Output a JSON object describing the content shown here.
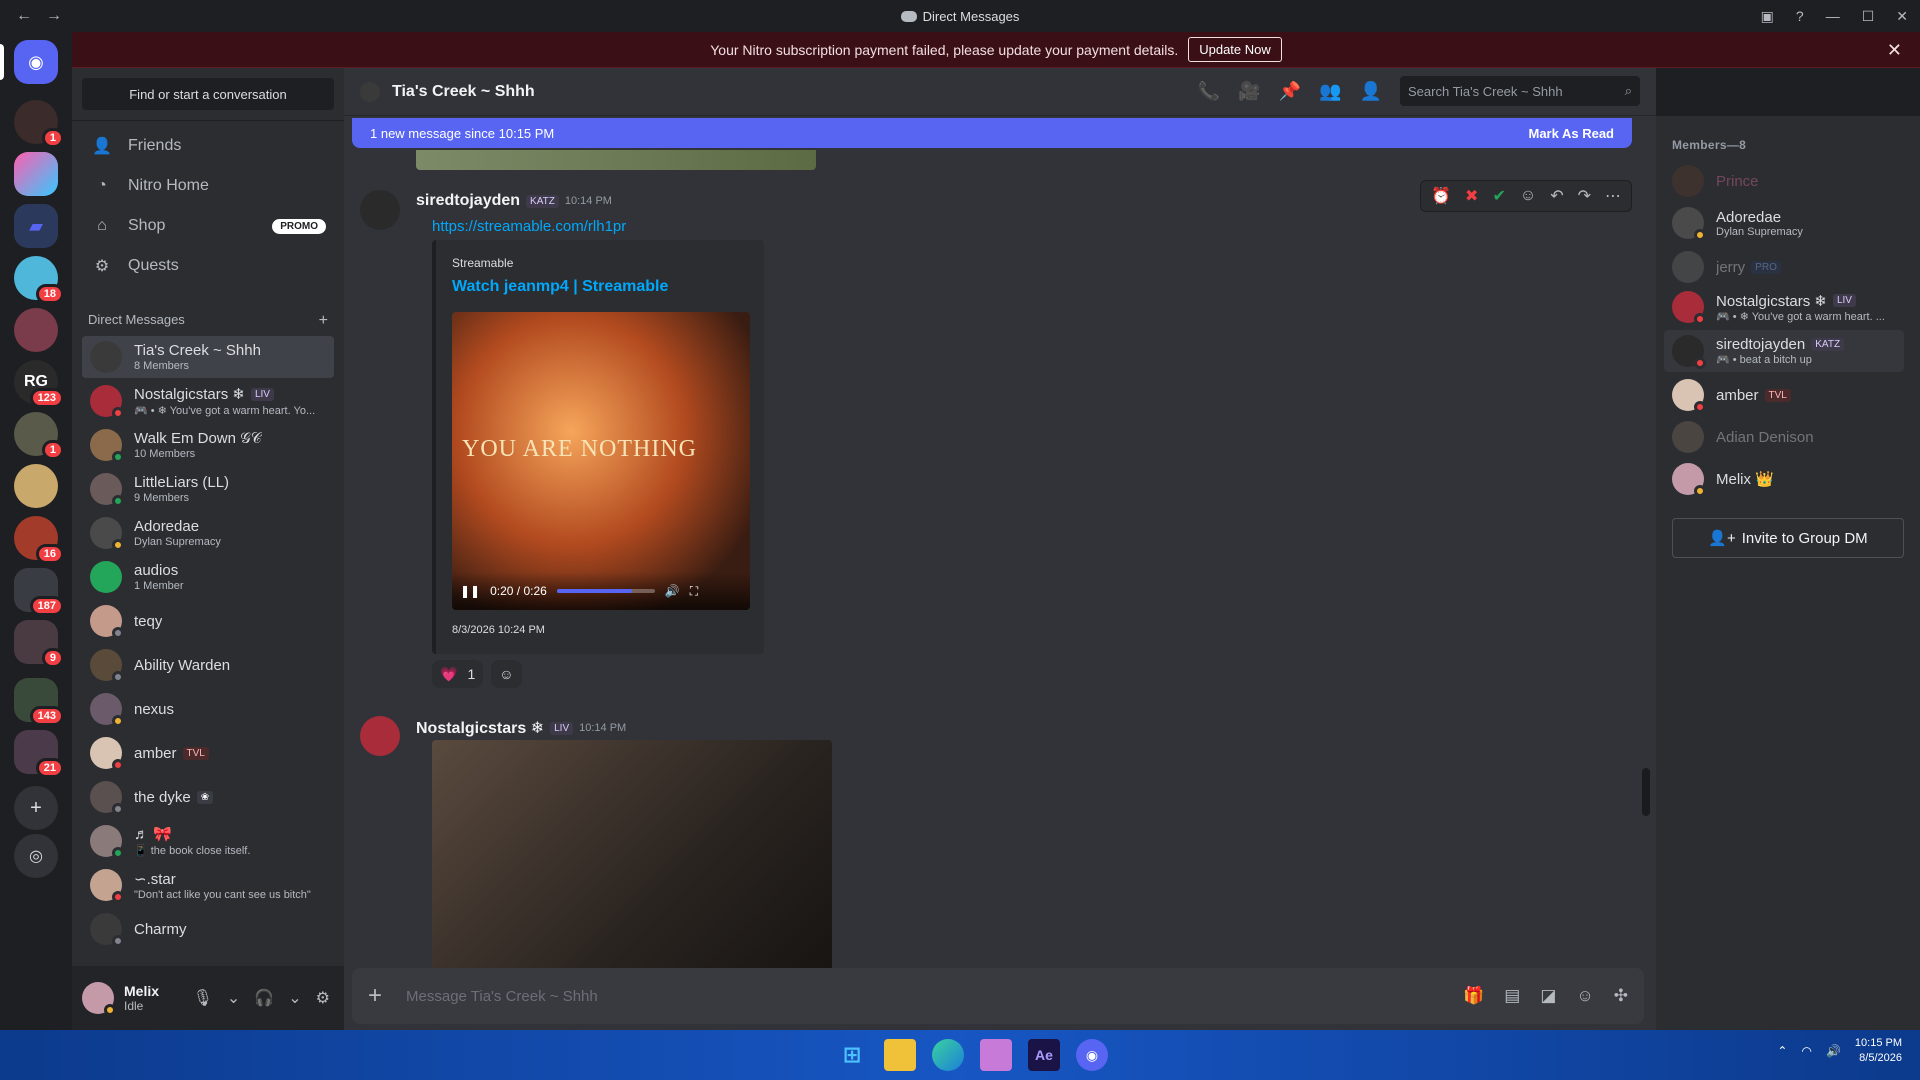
{
  "window": {
    "title": "Direct Messages"
  },
  "banner": {
    "text": "Your Nitro subscription payment failed, please update your payment details.",
    "button": "Update Now"
  },
  "servers": {
    "badges": [
      "1",
      "18",
      "123",
      "1",
      "16",
      "187",
      "9",
      "143",
      "21"
    ]
  },
  "sidebar": {
    "search": "Find or start a conversation",
    "nav": [
      {
        "label": "Friends"
      },
      {
        "label": "Nitro Home"
      },
      {
        "label": "Shop",
        "badge": "PROMO"
      },
      {
        "label": "Quests"
      }
    ],
    "dm_header": "Direct Messages",
    "dms": [
      {
        "name": "Tia's Creek ~ Shhh",
        "sub": "8 Members"
      },
      {
        "name": "Nostalgicstars ❄",
        "tag": "LIV",
        "sub": "🎮 • ❄ You've got a warm heart. Yo..."
      },
      {
        "name": "Walk Em Down 𝒢𝒞",
        "sub": "10 Members"
      },
      {
        "name": "LittleLiars (LL)",
        "sub": "9 Members"
      },
      {
        "name": "Adoredae",
        "sub": "Dylan Supremacy"
      },
      {
        "name": "audios",
        "sub": "1 Member"
      },
      {
        "name": "teqy",
        "sub": ""
      },
      {
        "name": "Ability Warden",
        "sub": ""
      },
      {
        "name": "nexus",
        "sub": ""
      },
      {
        "name": "amber",
        "tag": "TVL",
        "sub": ""
      },
      {
        "name": "the dyke",
        "tag": "❀",
        "sub": ""
      },
      {
        "name": "♬ 🎀",
        "sub": "📱 the book close itself."
      },
      {
        "name": "∽.star",
        "sub": "\"Don't act like you cant see us bitch\""
      },
      {
        "name": "Charmy",
        "sub": ""
      }
    ],
    "user": {
      "name": "Melix",
      "status": "Idle"
    }
  },
  "chat": {
    "title": "Tia's Creek ~ Shhh",
    "search_placeholder": "Search Tia's Creek ~ Shhh",
    "newbar": {
      "text": "1 new message since 10:15 PM",
      "action": "Mark As Read"
    },
    "messages": [
      {
        "author": "siredtojayden",
        "tag": "KATZ",
        "time": "10:14 PM",
        "link": "https://streamable.com/rlh1pr",
        "embed": {
          "provider": "Streamable",
          "title": "Watch jeanmp4 | Streamable",
          "caption": "YOU ARE NOTHING",
          "time": "0:20 / 0:26",
          "progress": 0.77,
          "date": "8/3/2026 10:24 PM"
        },
        "reaction": "1"
      },
      {
        "author": "Nostalgicstars ❄",
        "tag": "LIV",
        "time": "10:14 PM"
      }
    ],
    "composer_placeholder": "Message Tia's Creek ~ Shhh"
  },
  "members": {
    "header": "Members—8",
    "list": [
      {
        "name": "Prince",
        "sub": "",
        "offline": true
      },
      {
        "name": "Adoredae",
        "sub": "Dylan Supremacy"
      },
      {
        "name": "jerry",
        "tag": "PRO",
        "sub": "",
        "offline": true
      },
      {
        "name": "Nostalgicstars ❄",
        "tag": "LIV",
        "sub": "🎮 • ❄ You've got a warm heart. ..."
      },
      {
        "name": "siredtojayden",
        "tag": "KATZ",
        "sub": "🎮 • beat a bitch up"
      },
      {
        "name": "amber",
        "tag": "TVL",
        "sub": ""
      },
      {
        "name": "Adian Denison",
        "sub": "",
        "offline": true
      },
      {
        "name": "Melix 👑",
        "sub": ""
      }
    ],
    "invite": "Invite to Group DM"
  },
  "taskbar": {
    "time": "10:15 PM",
    "date": "8/5/2026"
  },
  "colors": {
    "blurple": "#5865f2",
    "link": "#00a8fc",
    "online": "#23a55a",
    "idle": "#f0b232",
    "dnd": "#f23f43"
  }
}
